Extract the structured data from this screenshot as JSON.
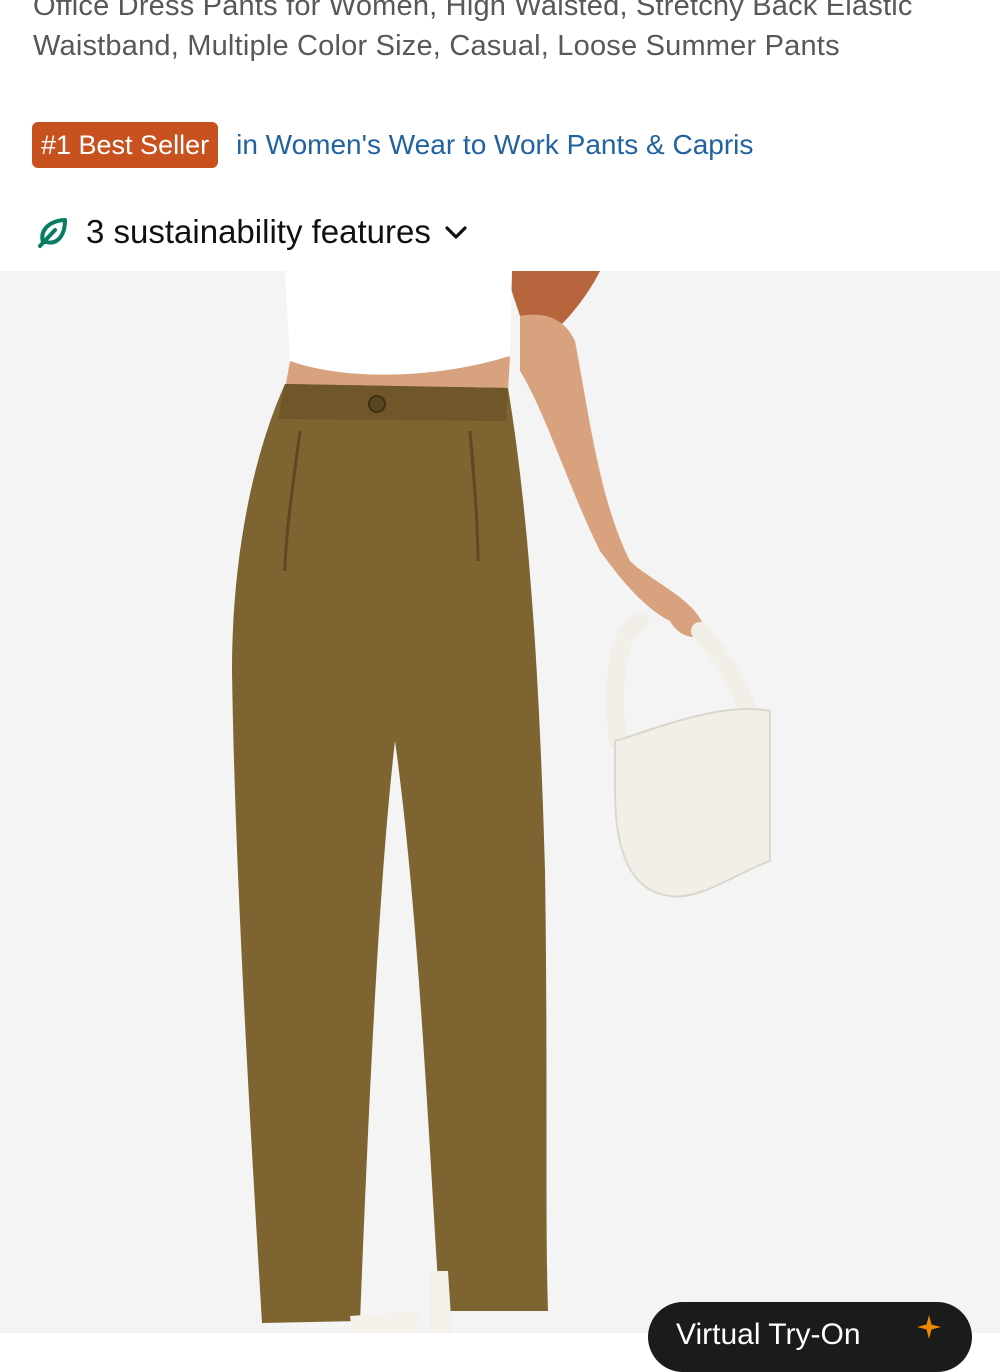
{
  "product": {
    "title": "Office Dress Pants for Women, High Waisted, Stretchy Back Elastic Waistband, Multiple Color Size, Casual, Loose Summer Pants",
    "badge": "#1 Best Seller",
    "category": "in Women's Wear to Work Pants & Capris",
    "sustainability": "3 sustainability features",
    "icons": {
      "sustainability": "leaf-icon",
      "expand": "chevron-down-icon"
    }
  },
  "image": {
    "alt": "olive wide-leg trousers with white crop top and white shoulder bag"
  },
  "try_on": {
    "label": "Virtual Try-On",
    "icon": "sparkle-icon"
  },
  "colors": {
    "badge": "#c7511f",
    "link": "#2162a1",
    "leaf": "#067d62",
    "pants": "#7d6431"
  }
}
